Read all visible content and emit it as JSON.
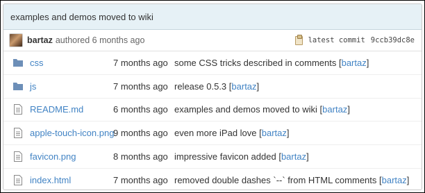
{
  "commit": {
    "message": "examples and demos moved to wiki",
    "author": "bartaz",
    "authored_text": "authored 6 months ago",
    "latest_label": "latest commit",
    "hash": "9ccb39dc8e"
  },
  "files": [
    {
      "type": "folder",
      "icon": "folder-icon",
      "name": "css",
      "age": "7 months ago",
      "message": "some CSS tricks described in comments",
      "author": "bartaz"
    },
    {
      "type": "folder",
      "icon": "folder-icon",
      "name": "js",
      "age": "7 months ago",
      "message": "release 0.5.3",
      "author": "bartaz"
    },
    {
      "type": "file",
      "icon": "file-icon",
      "name": "README.md",
      "age": "6 months ago",
      "message": "examples and demos moved to wiki",
      "author": "bartaz"
    },
    {
      "type": "file",
      "icon": "file-icon",
      "name": "apple-touch-icon.png",
      "age": "9 months ago",
      "message": "even more iPad love",
      "author": "bartaz"
    },
    {
      "type": "file",
      "icon": "file-icon",
      "name": "favicon.png",
      "age": "8 months ago",
      "message": "impressive favicon added",
      "author": "bartaz"
    },
    {
      "type": "file",
      "icon": "file-icon",
      "name": "index.html",
      "age": "7 months ago",
      "message": "removed double dashes `--` from HTML comments",
      "author": "bartaz"
    }
  ],
  "colors": {
    "link": "#4183c4",
    "header_bg": "#e6f1f6",
    "folder": "#6d8fb8"
  }
}
